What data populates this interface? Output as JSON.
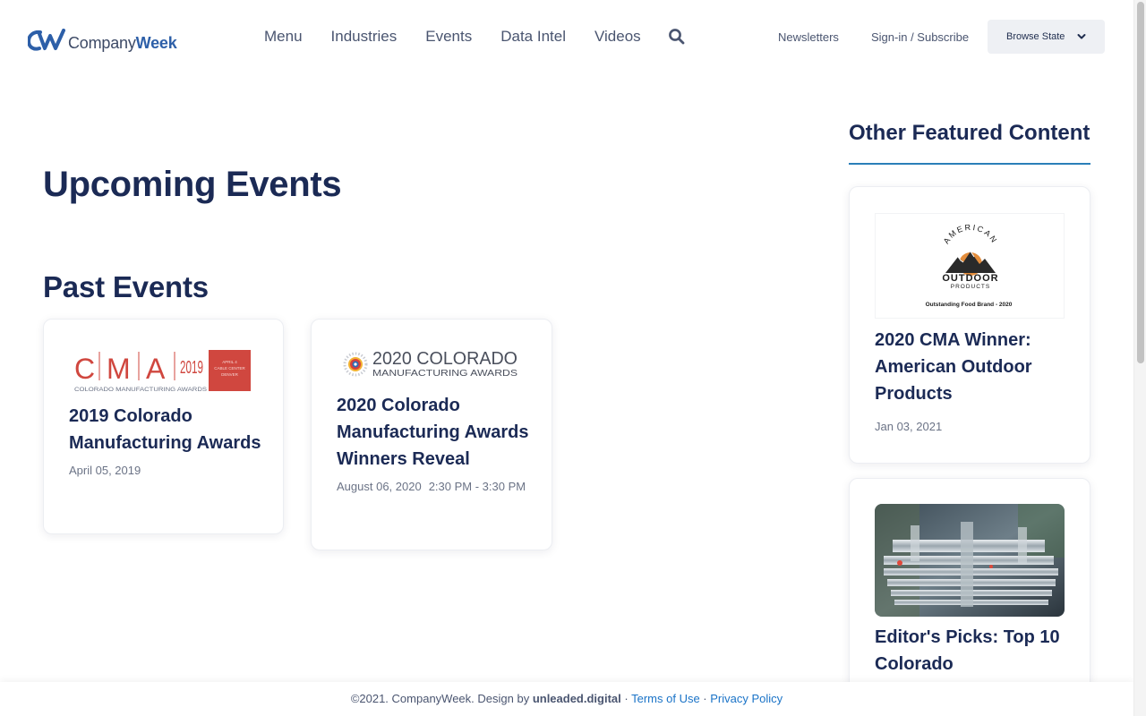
{
  "header": {
    "logo": {
      "mark": "CW",
      "text_plain": "Company",
      "text_bold": "Week"
    },
    "nav": [
      "Menu",
      "Industries",
      "Events",
      "Data Intel",
      "Videos"
    ],
    "search_icon": "search-icon",
    "newsletters": "Newsletters",
    "signin": "Sign-in / Subscribe",
    "browse_state": "Browse State"
  },
  "main": {
    "upcoming_title": "Upcoming Events",
    "past_title": "Past Events",
    "past_events": [
      {
        "logo": {
          "letters": [
            "C",
            "M",
            "A"
          ],
          "year": "2019",
          "box_text": [
            "APRIL 4",
            "CABLE CENTER",
            "DENVER"
          ],
          "caption": "COLORADO MANUFACTURING AWARDS"
        },
        "title": "2019 Colorado Manufacturing Awards",
        "date": "April 05, 2019",
        "time": ""
      },
      {
        "logo": {
          "line1": "2020 COLORADO",
          "line2": "MANUFACTURING AWARDS"
        },
        "title": "2020 Colorado Manufacturing Awards Winners Reveal",
        "date": "August 06, 2020",
        "time": "2:30 PM - 3:30 PM"
      }
    ]
  },
  "sidebar": {
    "title": "Other Featured Content",
    "items": [
      {
        "image": {
          "arc_text": "AMERICAN",
          "word1": "OUTDOOR",
          "word2": "PRODUCTS",
          "caption": "Outstanding Food Brand - 2020"
        },
        "title": "2020 CMA Winner: American Outdoor Products",
        "date": "Jan 03, 2021"
      },
      {
        "image": {
          "alt": "machining-photo"
        },
        "title": "Editor's Picks: Top 10 Colorado",
        "date": ""
      }
    ]
  },
  "footer": {
    "copyright": "©2021. CompanyWeek. Design by ",
    "designer": "unleaded.digital",
    "sep": " · ",
    "terms": "Terms of Use",
    "privacy": "Privacy Policy"
  },
  "colors": {
    "navy": "#1b2a55",
    "accent_blue": "#2a7fb8",
    "cma_red": "#d0473f",
    "link": "#1a73c7"
  }
}
